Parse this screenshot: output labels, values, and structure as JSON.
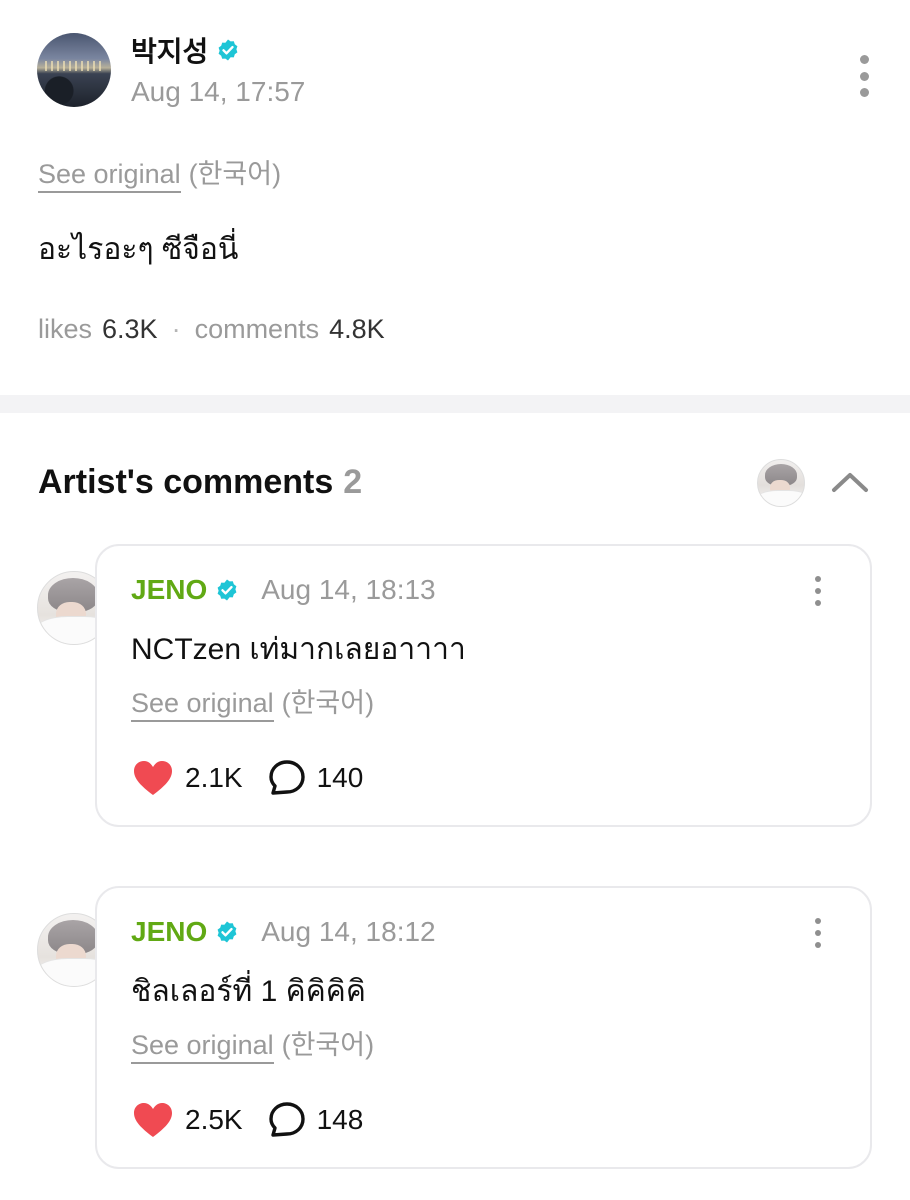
{
  "post": {
    "author": "박지성",
    "date": "Aug 14, 17:57",
    "see_original": "See original",
    "language": "(한국어)",
    "body": "อะไรอะๆ ซีจือนี่",
    "likes_label": "likes",
    "likes_value": "6.3K",
    "separator": "·",
    "comments_label": "comments",
    "comments_value": "4.8K"
  },
  "section": {
    "title": "Artist's comments",
    "count": "2"
  },
  "comments": [
    {
      "author": "JENO",
      "date": "Aug 14, 18:13",
      "text": "NCTzen เท่มากเลยอาาาา",
      "see_original": "See original",
      "language": "(한국어)",
      "likes": "2.1K",
      "replies": "140"
    },
    {
      "author": "JENO",
      "date": "Aug 14, 18:12",
      "text": "ชิลเลอร์ที่ 1 คิคิคิคิ",
      "see_original": "See original",
      "language": "(한국어)",
      "likes": "2.5K",
      "replies": "148"
    }
  ],
  "colors": {
    "verified": "#1ec5d6",
    "artist_name": "#61a914",
    "heart": "#f04a52",
    "muted_text": "#9a9a9a"
  },
  "icons": [
    "verified-icon",
    "more-vertical-icon",
    "chevron-up-icon",
    "heart-icon",
    "comment-bubble-icon"
  ]
}
